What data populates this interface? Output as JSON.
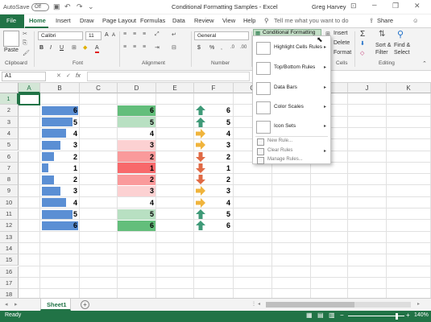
{
  "window": {
    "autosave_label": "AutoSave",
    "autosave_state": "Off",
    "title": "Conditional Formatting Samples  -  Excel",
    "user": "Greg Harvey"
  },
  "tabs": [
    "File",
    "Home",
    "Insert",
    "Draw",
    "Page Layout",
    "Formulas",
    "Data",
    "Review",
    "View",
    "Help"
  ],
  "tell_me": "Tell me what you want to do",
  "share": "Share",
  "ribbon": {
    "clipboard": {
      "paste": "Paste",
      "label": "Clipboard"
    },
    "font": {
      "name": "Calibri",
      "size": "11",
      "bold": "B",
      "italic": "I",
      "underline": "U",
      "grow": "A",
      "label": "Font"
    },
    "alignment": {
      "label": "Alignment"
    },
    "number": {
      "format": "General",
      "currency": "$",
      "percent": "%",
      "label": "Number"
    },
    "styles": {
      "conditional_formatting": "Conditional Formatting"
    },
    "cells": {
      "insert": "Insert",
      "delete": "Delete",
      "format": "Format",
      "label": "Cells"
    },
    "editing": {
      "sum": "Σ",
      "sort": "Sort &",
      "filter": "Filter",
      "find": "Find &",
      "select": "Select",
      "label": "Editing"
    }
  },
  "name_box": "A1",
  "fx": "fx",
  "columns": [
    "A",
    "B",
    "C",
    "D",
    "E",
    "F",
    "G",
    "H",
    "I",
    "J",
    "K"
  ],
  "rows": [
    "1",
    "2",
    "3",
    "4",
    "5",
    "6",
    "7",
    "8",
    "9",
    "10",
    "11",
    "12",
    "13",
    "14",
    "15",
    "16",
    "17",
    "18"
  ],
  "data": {
    "B": [
      6,
      5,
      4,
      3,
      2,
      1,
      2,
      3,
      4,
      5,
      6
    ],
    "D": [
      6,
      5,
      4,
      3,
      2,
      1,
      2,
      3,
      4,
      5,
      6
    ],
    "F": [
      6,
      5,
      4,
      3,
      2,
      1,
      2,
      3,
      4,
      5,
      6
    ],
    "arrows": [
      "up",
      "up",
      "side",
      "side",
      "down",
      "down",
      "down",
      "side",
      "side",
      "up",
      "up"
    ]
  },
  "colors": {
    "accent": "#217346",
    "databar": "#5b8fd4",
    "green_dark": "#63be7b",
    "green_light": "#b8e0c2",
    "red_dark": "#f8696b",
    "red_mid": "#fa9a9b",
    "red_light": "#fcd1d2",
    "arrow_up": "#3f9a78",
    "arrow_side": "#f0b43c",
    "arrow_down": "#e06a45"
  },
  "menu": {
    "items": [
      "Highlight Cells Rules",
      "Top/Bottom Rules",
      "Data Bars",
      "Color Scales",
      "Icon Sets"
    ],
    "sub": [
      "New Rule...",
      "Clear Rules",
      "Manage Rules..."
    ]
  },
  "sheet": {
    "tab": "Sheet1",
    "add": "+"
  },
  "status": {
    "text": "Ready",
    "zoom": "140%"
  }
}
